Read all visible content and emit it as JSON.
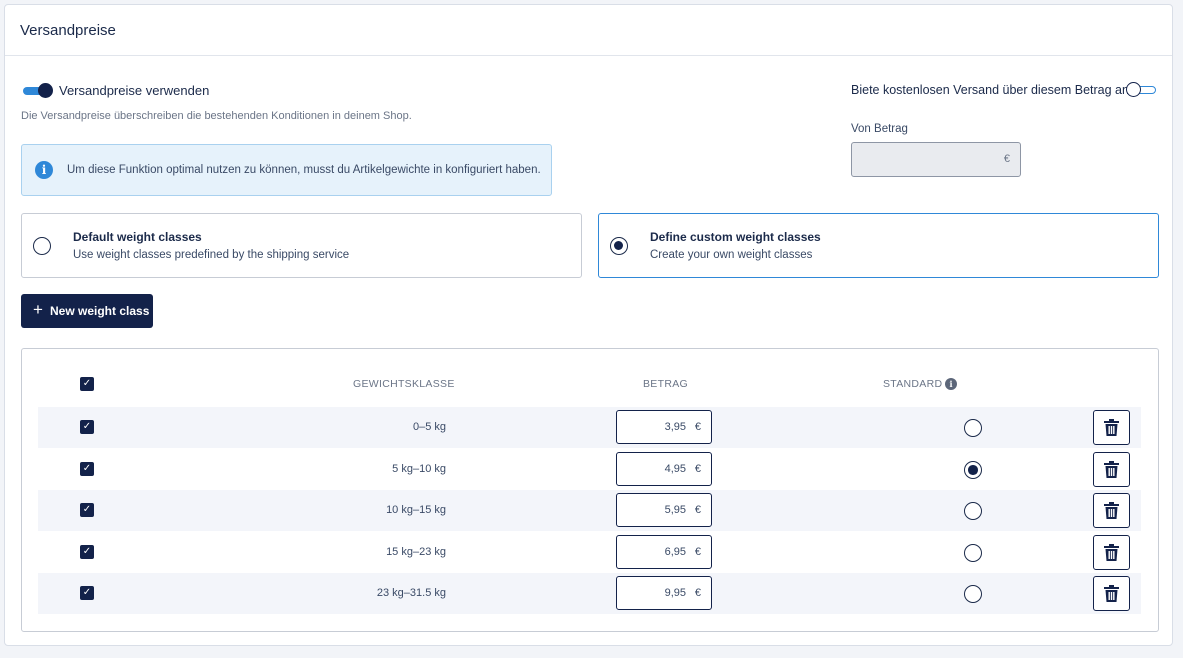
{
  "card": {
    "title": "Versandpreise"
  },
  "shipping": {
    "toggle_label": "Versandpreise verwenden",
    "toggle_on": true,
    "subtext": "Die Versandpreise überschreiben die bestehenden Konditionen in deinem Shop.",
    "info_text": "Um diese Funktion optimal nutzen zu können, musst du Artikelgewichte in konfiguriert haben."
  },
  "free_shipping": {
    "label": "Biete kostenlosen Versand über diesem Betrag an",
    "toggle_on": false,
    "from_label": "Von Betrag",
    "currency": "€",
    "value": ""
  },
  "options": [
    {
      "title": "Default weight classes",
      "description": "Use weight classes predefined by the shipping service",
      "selected": false
    },
    {
      "title": "Define custom weight classes",
      "description": "Create your own weight classes",
      "selected": true
    }
  ],
  "new_button": {
    "label": "New weight class",
    "icon": "plus-icon"
  },
  "table": {
    "headers": {
      "weight_class": "GEWICHTSKLASSE",
      "amount": "BETRAG",
      "standard": "STANDARD"
    },
    "rows": [
      {
        "weight": "0–5 kg",
        "amount": "3,95",
        "currency": "€",
        "standard": false,
        "checked": true
      },
      {
        "weight": "5 kg–10 kg",
        "amount": "4,95",
        "currency": "€",
        "standard": true,
        "checked": true
      },
      {
        "weight": "10 kg–15 kg",
        "amount": "5,95",
        "currency": "€",
        "standard": false,
        "checked": true
      },
      {
        "weight": "15 kg–23 kg",
        "amount": "6,95",
        "currency": "€",
        "standard": false,
        "checked": true
      },
      {
        "weight": "23 kg–31.5 kg",
        "amount": "9,95",
        "currency": "€",
        "standard": false,
        "checked": true
      }
    ]
  },
  "colors": {
    "primary": "#13224a",
    "accent": "#2f88d8",
    "info_bg": "#e6f2fb",
    "row_alt": "#f3f5fa"
  }
}
